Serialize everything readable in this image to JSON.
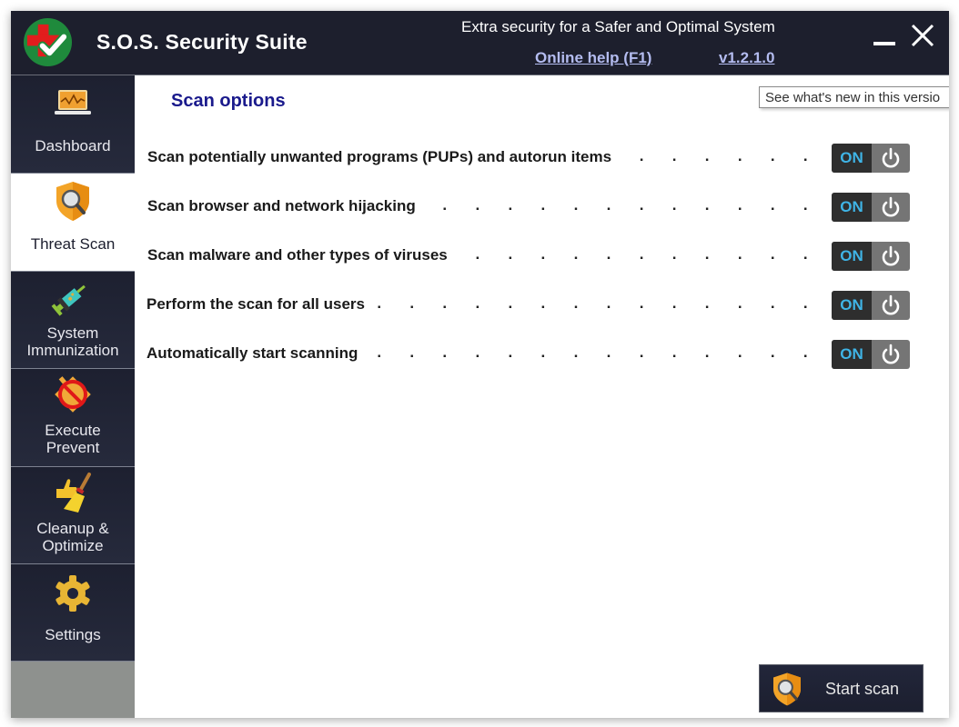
{
  "app": {
    "title": "S.O.S. Security Suite",
    "tagline": "Extra security for a Safer and Optimal System",
    "help_link": "Online help (F1)",
    "version": "v1.2.1.0",
    "tooltip": "See what's new in this versio"
  },
  "sidebar": {
    "items": [
      {
        "label": "Dashboard",
        "icon": "laptop-chart-icon",
        "active": false
      },
      {
        "label": "Threat Scan",
        "icon": "shield-magnifier-icon",
        "active": true
      },
      {
        "label_line1": "System",
        "label_line2": "Immunization",
        "icon": "syringe-icon",
        "active": false
      },
      {
        "label_line1": "Execute",
        "label_line2": "Prevent",
        "icon": "block-execute-icon",
        "active": false
      },
      {
        "label_line1": "Cleanup &",
        "label_line2": "Optimize",
        "icon": "thumb-broom-icon",
        "active": false
      },
      {
        "label": "Settings",
        "icon": "gear-icon",
        "active": false
      }
    ]
  },
  "main": {
    "section_title": "Scan options",
    "dots": ". . . . . . . . . . . . . . . . . . . . . . . . . . . . . . . . . . . . . . . . . . . . . . . .",
    "options": [
      {
        "label": "Scan potentially unwanted programs (PUPs) and autorun items",
        "state": "ON"
      },
      {
        "label": "Scan browser and network hijacking",
        "state": "ON"
      },
      {
        "label": "Scan malware and other types of viruses",
        "state": "ON"
      },
      {
        "label": "Perform the scan for all users",
        "state": "ON"
      },
      {
        "label": "Automatically start scanning",
        "state": "ON"
      }
    ],
    "start_button": "Start scan"
  },
  "colors": {
    "titlebar": "#1d1f2d",
    "section_title": "#1a1a8c",
    "toggle_on_text": "#3fb4e6",
    "link": "#b4bcf0"
  }
}
